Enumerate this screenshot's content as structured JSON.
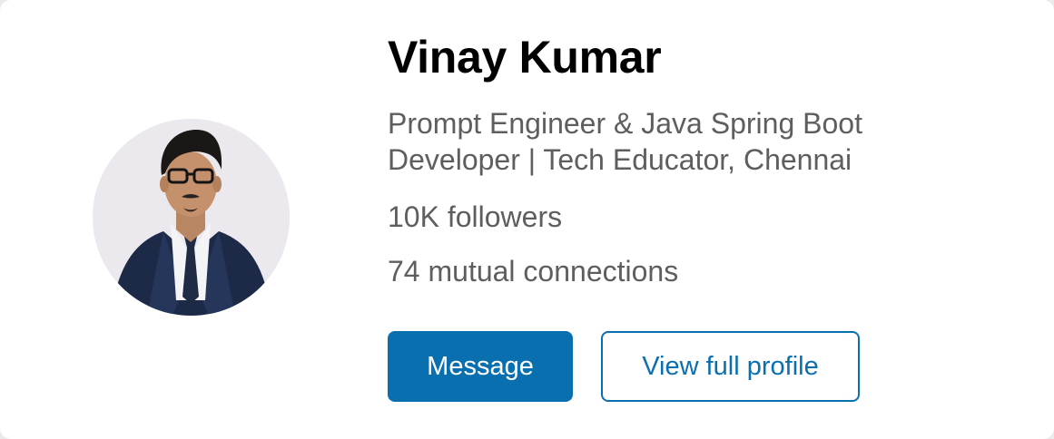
{
  "profile": {
    "name": "Vinay Kumar",
    "headline": "Prompt Engineer & Java Spring Boot Developer | Tech Educator, Chennai",
    "followers": "10K followers",
    "mutual_connections": "74 mutual connections",
    "avatar_icon": "profile-photo"
  },
  "actions": {
    "message_label": "Message",
    "view_profile_label": "View full profile"
  },
  "colors": {
    "primary": "#0a6fae",
    "muted_text": "#5e5e5e",
    "name_text": "#000000",
    "background": "#ffffff"
  }
}
